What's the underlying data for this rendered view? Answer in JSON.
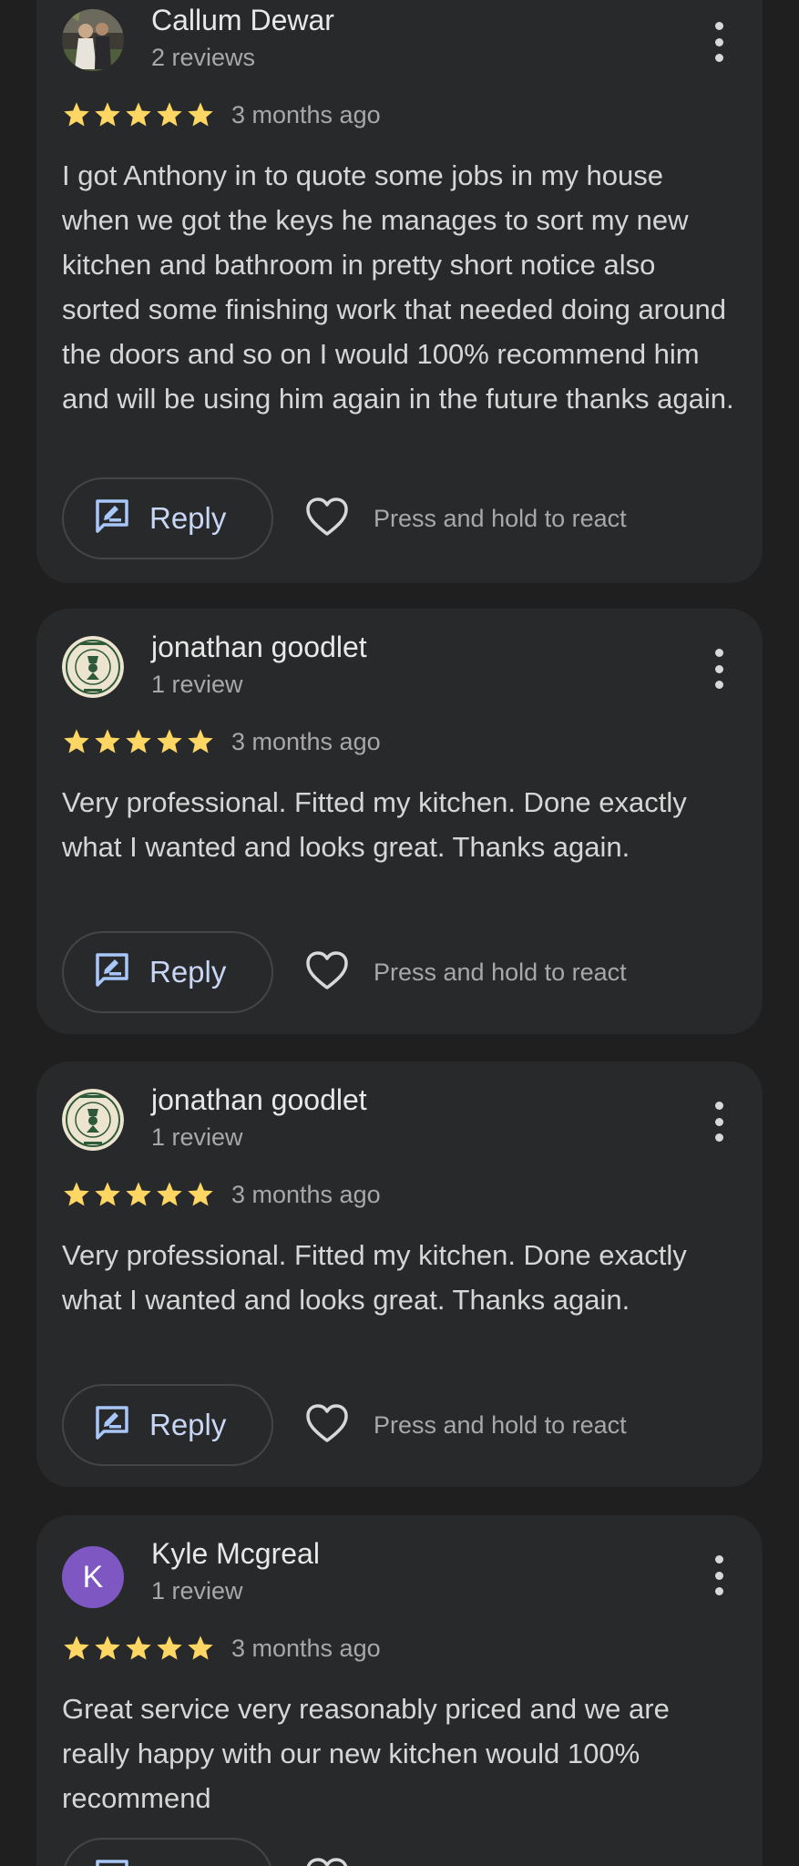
{
  "reviews": [
    {
      "name": "Callum Dewar",
      "meta": "2 reviews",
      "rating": 5,
      "time": "3 months ago",
      "text": "I got Anthony in to quote some jobs in my house when we got the keys he manages to sort my new kitchen and bathroom in pretty short notice also sorted some finishing work that needed doing around the doors and so on I would 100% recommend him and will be using him again in the future thanks again.",
      "avatar": "photo"
    },
    {
      "name": "jonathan goodlet",
      "meta": "1 review",
      "rating": 5,
      "time": "3 months ago",
      "text": "Very professional. Fitted my kitchen. Done exactly what I wanted and looks great. Thanks again.",
      "avatar": "logo",
      "avatar_logo_text": [
        "THE THREE PUTT",
        "BANDIT"
      ]
    },
    {
      "name": "jonathan goodlet",
      "meta": "1 review",
      "rating": 5,
      "time": "3 months ago",
      "text": "Very professional. Fitted my kitchen. Done exactly what I wanted and looks great. Thanks again.",
      "avatar": "logo",
      "avatar_logo_text": [
        "THE THREE PUTT",
        "BANDIT"
      ]
    },
    {
      "name": "Kyle Mcgreal",
      "meta": "1 review",
      "rating": 5,
      "time": "3 months ago",
      "text": "Great service very reasonably priced and we are really happy with our new kitchen would 100% recommend",
      "avatar": "letter",
      "avatar_letter": "K"
    }
  ],
  "actions": {
    "reply_label": "Reply",
    "react_label": "Press and hold to react"
  },
  "icons": {
    "reply": "edit-reply-icon",
    "react": "heart-outline-icon",
    "more": "more-vertical-icon",
    "star": "star-icon"
  },
  "colors": {
    "background": "#1f1f1f",
    "card": "#28292b",
    "star": "#fdd663",
    "reply_accent": "#a8c7fa",
    "avatar_letter_bg": "#7e57c2"
  }
}
